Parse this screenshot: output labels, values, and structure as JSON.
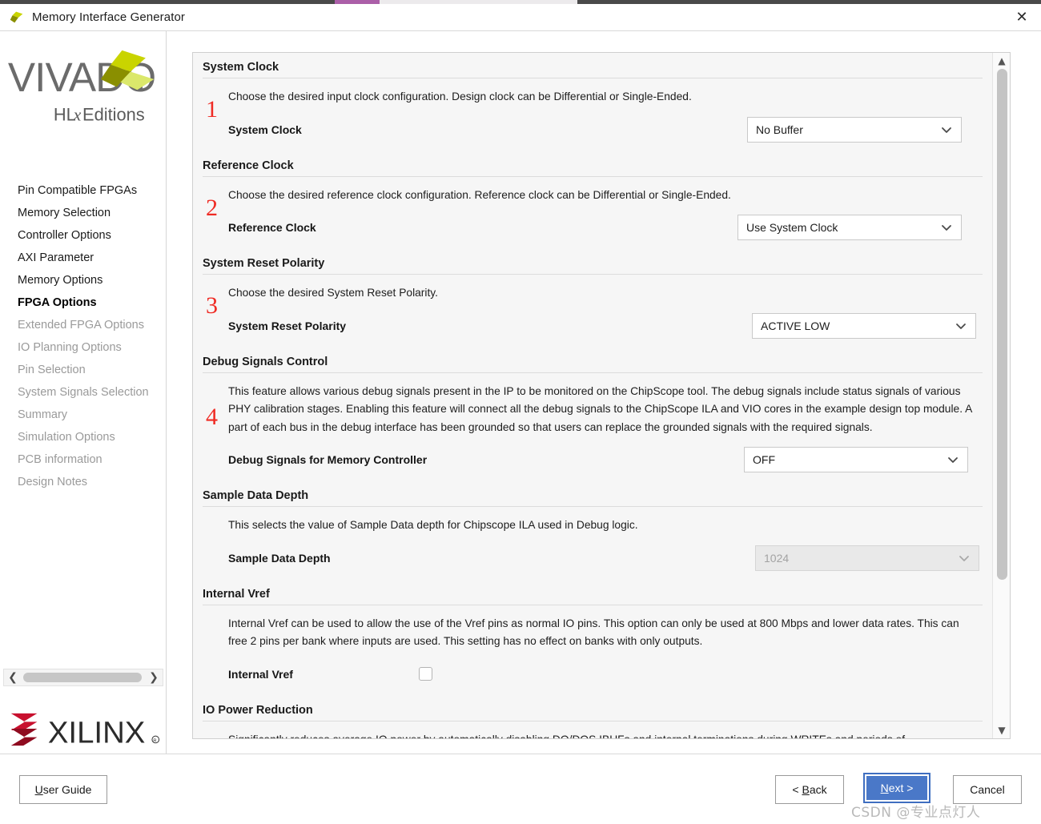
{
  "window": {
    "title": "Memory Interface Generator",
    "app_icon": "vivado-mark-icon",
    "close_label": "✕"
  },
  "sidebar": {
    "logo_text": "VIVADO",
    "logo_subtext": "HLx Editions",
    "brand_footer": "XILINX",
    "items": [
      {
        "label": "Pin Compatible FPGAs",
        "state": "enabled"
      },
      {
        "label": "Memory Selection",
        "state": "enabled"
      },
      {
        "label": "Controller Options",
        "state": "enabled"
      },
      {
        "label": "AXI Parameter",
        "state": "enabled"
      },
      {
        "label": "Memory Options",
        "state": "enabled"
      },
      {
        "label": "FPGA Options",
        "state": "active"
      },
      {
        "label": "Extended FPGA Options",
        "state": "disabled"
      },
      {
        "label": "IO Planning Options",
        "state": "disabled"
      },
      {
        "label": "Pin Selection",
        "state": "disabled"
      },
      {
        "label": "System Signals Selection",
        "state": "disabled"
      },
      {
        "label": "Summary",
        "state": "disabled"
      },
      {
        "label": "Simulation Options",
        "state": "disabled"
      },
      {
        "label": "PCB information",
        "state": "disabled"
      },
      {
        "label": "Design Notes",
        "state": "disabled"
      }
    ],
    "hscroll": {
      "left_icon": "chevron-left-icon",
      "right_icon": "chevron-right-icon"
    }
  },
  "content": {
    "scrollbar": {
      "up_icon": "chevron-up-icon",
      "down_icon": "chevron-down-icon"
    },
    "sections": [
      {
        "annotation": "1",
        "title": "System Clock",
        "description": "Choose the desired input clock configuration. Design clock can be Differential or Single-Ended.",
        "field_label": "System Clock",
        "control": {
          "kind": "dropdown",
          "value": "No Buffer",
          "disabled": false
        }
      },
      {
        "annotation": "2",
        "title": "Reference Clock",
        "description": "Choose the desired reference clock configuration. Reference clock can be Differential or Single-Ended.",
        "field_label": "Reference Clock",
        "control": {
          "kind": "dropdown",
          "value": "Use System Clock",
          "disabled": false
        }
      },
      {
        "annotation": "3",
        "title": "System Reset Polarity",
        "description": "Choose the desired System Reset Polarity.",
        "field_label": "System Reset Polarity",
        "control": {
          "kind": "dropdown",
          "value": "ACTIVE LOW",
          "disabled": false
        }
      },
      {
        "annotation": "4",
        "title": "Debug Signals Control",
        "description": "This feature allows various debug signals present in the IP to be monitored on the ChipScope tool. The debug signals include status signals of various PHY calibration stages. Enabling this feature will connect all the debug signals to the ChipScope ILA and VIO cores in the example design top module. A part of each bus in the debug interface has been grounded so that users can replace the grounded signals with the required signals.",
        "field_label": "Debug Signals for Memory Controller",
        "control": {
          "kind": "dropdown",
          "value": "OFF",
          "disabled": false
        }
      },
      {
        "annotation": "",
        "title": "Sample Data Depth",
        "description": "This selects the value of Sample Data depth for Chipscope ILA used in Debug logic.",
        "field_label": "Sample Data Depth",
        "control": {
          "kind": "dropdown",
          "value": "1024",
          "disabled": true
        }
      },
      {
        "annotation": "",
        "title": "Internal Vref",
        "description": "Internal Vref can be used to allow the use of the Vref pins as normal IO pins. This option can only be used at 800 Mbps and lower data rates. This can free 2 pins per bank where inputs are used. This setting has no effect on banks with only outputs.",
        "field_label": "Internal Vref",
        "control": {
          "kind": "checkbox",
          "checked": false
        }
      },
      {
        "annotation": "",
        "title": "IO Power Reduction",
        "description": "Significantly reduces average IO power by automatically disabling DQ/DQS IBUFs and internal terminations during WRITEs and periods of",
        "field_label": "",
        "control": {
          "kind": "none"
        }
      }
    ]
  },
  "footer": {
    "user_guide": {
      "pre": "U",
      "mnemonic": "",
      "post": "ser Guide",
      "label": "User Guide"
    },
    "back": {
      "label": "< Back"
    },
    "next": {
      "label": "Next >"
    },
    "cancel": {
      "label": "Cancel"
    }
  },
  "watermark": {
    "text": "CSDN @专业点灯人"
  },
  "colors": {
    "annotation_red": "#ef2b24",
    "primary_button": "#4a78c8",
    "xilinx_red": "#c8102e",
    "vivado_green": "#c4d600"
  }
}
